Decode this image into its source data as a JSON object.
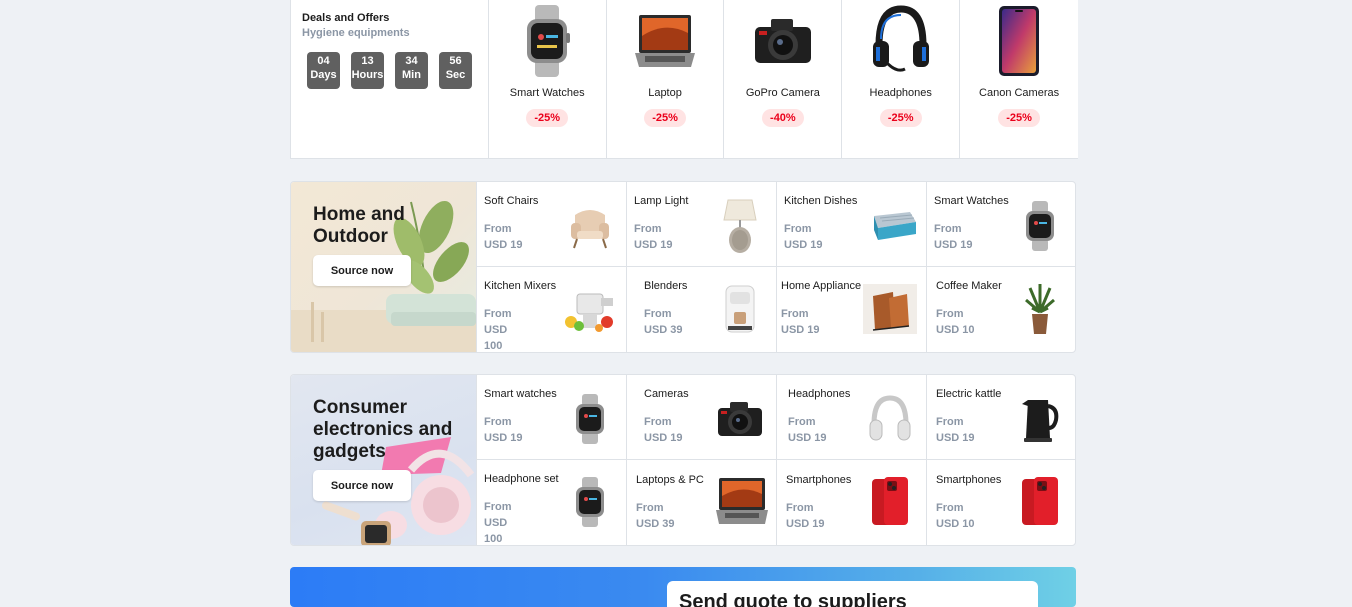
{
  "deals": {
    "title": "Deals and Offers",
    "subtitle": "Hygiene equipments",
    "timer": [
      {
        "num": "04",
        "label": "Days"
      },
      {
        "num": "13",
        "label": "Hours"
      },
      {
        "num": "34",
        "label": "Min"
      },
      {
        "num": "56",
        "label": "Sec"
      }
    ],
    "items": [
      {
        "name": "Smart Watches",
        "discount": "-25%",
        "icon": "smartwatch-icon"
      },
      {
        "name": "Laptop",
        "discount": "-25%",
        "icon": "laptop-icon"
      },
      {
        "name": "GoPro Camera",
        "discount": "-40%",
        "icon": "camera-icon"
      },
      {
        "name": "Headphones",
        "discount": "-25%",
        "icon": "headphones-icon"
      },
      {
        "name": "Canon Cameras",
        "discount": "-25%",
        "icon": "smartphone-icon"
      }
    ]
  },
  "home": {
    "title": "Home and Outdoor",
    "button": "Source now",
    "items": [
      {
        "name": "Soft Chairs",
        "from": "From",
        "price": "USD 19",
        "icon": "chair-icon"
      },
      {
        "name": "Lamp Light",
        "from": "From",
        "price": "USD 19",
        "icon": "lamp-icon"
      },
      {
        "name": "Kitchen Dishes",
        "from": "From",
        "price": "USD 19",
        "icon": "mattress-icon"
      },
      {
        "name": "Smart Watches",
        "from": "From",
        "price": "USD 19",
        "icon": "smartwatch-icon"
      },
      {
        "name": "Kitchen Mixers",
        "from": "From",
        "price": "USD 100",
        "icon": "mixer-icon"
      },
      {
        "name": "Blenders",
        "from": "From",
        "price": "USD 39",
        "icon": "coffee-machine-icon"
      },
      {
        "name": "Home Appliance",
        "from": "From",
        "price": "USD 19",
        "icon": "magazine-rack-icon"
      },
      {
        "name": "Coffee Maker",
        "from": "From",
        "price": "USD 10",
        "icon": "plant-icon"
      }
    ]
  },
  "electronics": {
    "title": "Consumer electronics and gadgets",
    "button": "Source now",
    "items": [
      {
        "name": "Smart watches",
        "from": "From",
        "price": "USD 19",
        "icon": "smartwatch-icon"
      },
      {
        "name": "Cameras",
        "from": "From",
        "price": "USD 19",
        "icon": "camera-icon"
      },
      {
        "name": "Headphones",
        "from": "From",
        "price": "USD 19",
        "icon": "headphones-icon"
      },
      {
        "name": "Electric kattle",
        "from": "From",
        "price": "USD 19",
        "icon": "kettle-icon"
      },
      {
        "name": "Headphone set",
        "from": "From",
        "price": "USD 100",
        "icon": "smartwatch-icon"
      },
      {
        "name": "Laptops & PC",
        "from": "From",
        "price": "USD 39",
        "icon": "laptop-icon"
      },
      {
        "name": "Smartphones",
        "from": "From",
        "price": "USD 19",
        "icon": "smartphone-red-icon"
      },
      {
        "name": "Smartphones",
        "from": "From",
        "price": "USD 10",
        "icon": "smartphone-red-icon"
      }
    ]
  },
  "quote": {
    "title": "Send quote to suppliers"
  },
  "colors": {
    "background": "#eef1f5",
    "discount_bg": "#ffe3e3",
    "discount_text": "#eb001b",
    "timer_bg": "#606060",
    "muted_text": "#8b96a5",
    "banner_blue": "#2c7cf6"
  }
}
